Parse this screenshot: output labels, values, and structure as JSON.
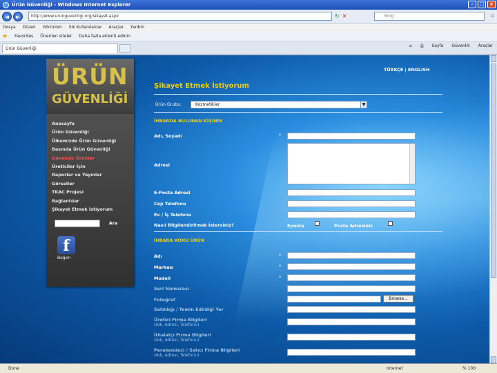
{
  "browser": {
    "window_title": "Ürün Güvenliği - Windows Internet Explorer",
    "url": "http://www.urunguvenligi.org/sikayet.aspx",
    "search_placeholder": "Bing",
    "menu": [
      "Dosya",
      "Düzen",
      "Görünüm",
      "Sık Kullanılanlar",
      "Araçlar",
      "Yardım"
    ],
    "favorites_label": "Favorites",
    "favorites_links": [
      "Önerilen siteler",
      "Daha fazla eklenti edinin"
    ],
    "tab_title": "Ürün Güvenliği",
    "command_items": [
      "Sayfa",
      "Güvenlik",
      "Araçlar"
    ],
    "status_text": "Done",
    "status_zone": "Internet",
    "status_zoom": "% 100"
  },
  "site": {
    "logo_line1": "ÜRÜN",
    "logo_line2": "GÜVENLİĞİ",
    "language_switch": "TÜRKÇE | ENGLISH",
    "nav": [
      {
        "label": "Anasayfa",
        "active": false
      },
      {
        "label": "Ürün Güvenliği",
        "active": false
      },
      {
        "label": "Ülkemizde Ürün Güvenliği",
        "active": false
      },
      {
        "label": "Basında Ürün Güvenliği",
        "active": false
      },
      {
        "label": "Güvensiz Ürünler",
        "active": true
      },
      {
        "label": "Üreticiler İçin",
        "active": false
      },
      {
        "label": "Raporlar ve Yayınlar",
        "active": false
      },
      {
        "label": "Görseller",
        "active": false
      },
      {
        "label": "TKAC Projesi",
        "active": false
      },
      {
        "label": "Bağlantılar",
        "active": false
      },
      {
        "label": "Şikayet Etmek İstiyorum",
        "active": false
      }
    ],
    "search_button": "Ara",
    "facebook_glyph": "f",
    "facebook_like": "Beğen"
  },
  "form": {
    "title": "Şikayet Etmek İstiyorum",
    "group_label": "Ürün Grubu:",
    "group_value": "Kozmetikler",
    "section_informant": "İHBARDA BULUNAN KİŞİNİN",
    "fields_informant": {
      "name": "Adı, Soyadı",
      "address": "Adresi",
      "email": "E-Posta Adresi",
      "mobile": "Cep Telefonu",
      "phone": "Ev / İş Telefonu",
      "contact_pref": "Nasıl Bilgilendirilmek İstersiniz?"
    },
    "contact_options": {
      "email": "Eposta",
      "post": "Posta Adresiniz"
    },
    "section_product": "İHBARA KONU ÜRÜN",
    "fields_product": {
      "name": "Adı",
      "brand": "Markası",
      "model": "Modeli",
      "serial": "Seri Numarası",
      "photo": "Fotoğraf",
      "purchase_place": "Satıldığı / Temin Edildiği Yer",
      "producer": "Üretici Firma Bilgileri",
      "producer_sub": "(Adı, Adresi, Telefonu)",
      "importer": "İthalatçı Firma Bilgileri",
      "importer_sub": "(Adı, Adresi, Telefonu)",
      "retailer": "Perakendeci / Satıcı Firma Bilgileri",
      "retailer_sub": "(Adı, Adresi, Telefonu)"
    },
    "required_mark": "*",
    "browse_button": "Browse..."
  }
}
